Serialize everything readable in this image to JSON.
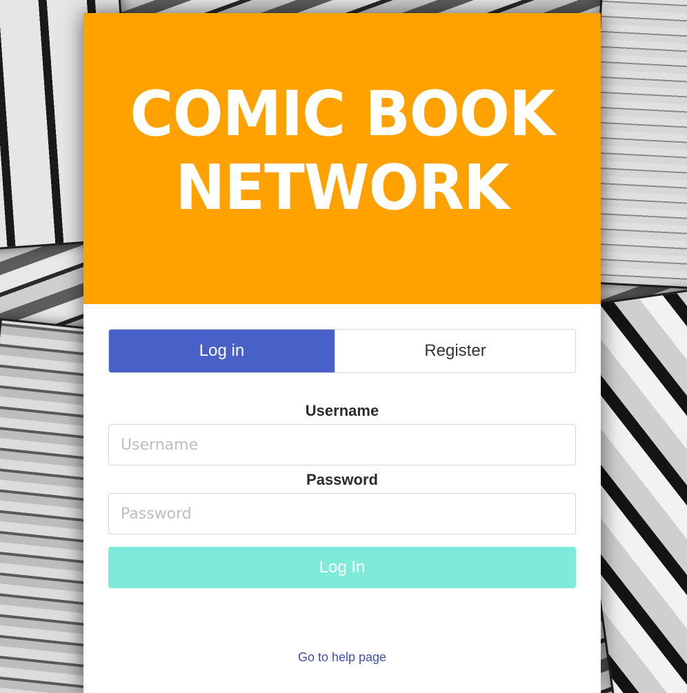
{
  "brand": {
    "line1": "COMIC BOOK",
    "line2": "NETWORK",
    "accent_color": "#ffa200"
  },
  "tabs": {
    "login_label": "Log in",
    "register_label": "Register",
    "active": "Log in",
    "active_color": "#4761c8"
  },
  "form": {
    "username_label": "Username",
    "username_placeholder": "Username",
    "username_value": "",
    "password_label": "Password",
    "password_placeholder": "Password",
    "password_value": "",
    "submit_label": "Log In",
    "submit_color": "#7eead9"
  },
  "footer": {
    "help_link": "Go to help page"
  },
  "background": {
    "description_icon": "comic-collage-background"
  }
}
